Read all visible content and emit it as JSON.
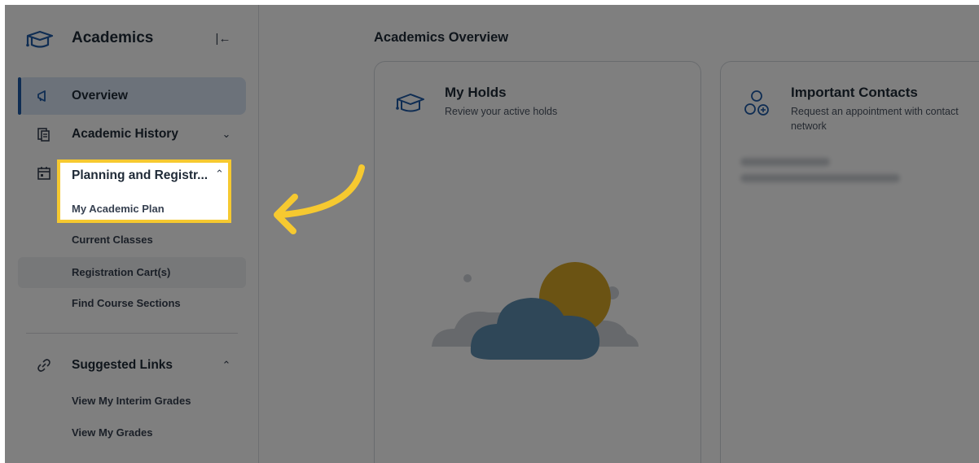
{
  "sidebar": {
    "title": "Academics",
    "collapse_icon": "collapse-left-icon",
    "items": [
      {
        "label": "Overview",
        "icon": "megaphone-icon",
        "active": true
      },
      {
        "label": "Academic History",
        "icon": "document-history-icon",
        "chevron": "chevron-down-icon"
      },
      {
        "label": "Planning and Registr...",
        "icon": "calendar-icon",
        "chevron": "chevron-up-icon"
      },
      {
        "label": "Suggested Links",
        "icon": "link-icon",
        "chevron": "chevron-up-icon"
      }
    ],
    "planning_sub": [
      "My Academic Plan",
      "Current Classes",
      "Registration Cart(s)",
      "Find Course Sections"
    ],
    "links_sub": [
      "View My Interim Grades",
      "View My Grades"
    ]
  },
  "main": {
    "title": "Academics Overview",
    "cards": [
      {
        "title": "My Holds",
        "subtitle": "Review your active holds",
        "icon": "graduation-cap-icon",
        "illustration": "sun-cloud-illustration"
      },
      {
        "title": "Important Contacts",
        "subtitle": "Request an appointment with contact network",
        "icon": "contacts-network-icon"
      }
    ]
  },
  "colors": {
    "accent": "#1f5aa6",
    "highlight": "#f6c930",
    "overlay": "rgba(0,0,0,0.5)"
  }
}
